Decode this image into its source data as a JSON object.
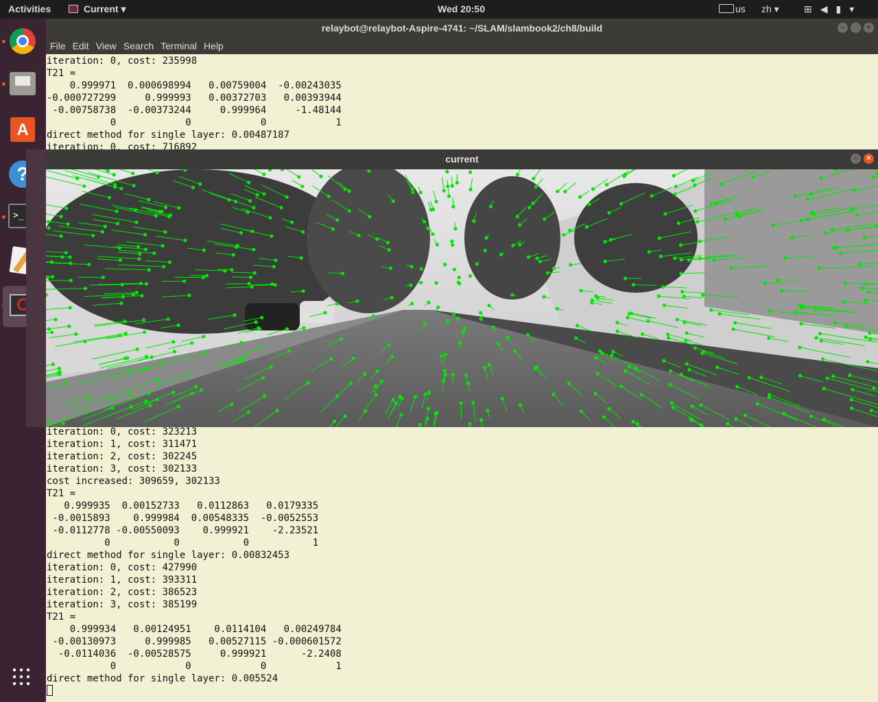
{
  "topbar": {
    "activities": "Activities",
    "app_menu": "Current",
    "clock": "Wed 20:50",
    "keyboard_layout": "us",
    "input_method": "zh"
  },
  "launcher": {
    "apps": [
      "chrome-icon",
      "files-icon",
      "software-center-icon",
      "help-icon",
      "terminal-icon",
      "text-editor-icon",
      "current-app-icon",
      "show-apps-icon"
    ],
    "accent": "#e95420"
  },
  "terminal": {
    "title": "relaybot@relaybot-Aspire-4741: ~/SLAM/slambook2/ch8/build",
    "menu": [
      "File",
      "Edit",
      "View",
      "Search",
      "Terminal",
      "Help"
    ],
    "background": "#f2f1d3",
    "output_top": "iteration: 0, cost: 235998\nT21 =\n    0.999971  0.000698994   0.00759004  -0.00243035\n-0.000727299     0.999993   0.00372703   0.00393944\n -0.00758738  -0.00373244     0.999964     -1.48144\n           0            0            0            1\ndirect method for single layer: 0.00487187\niteration: 0, cost: 716892",
    "output_bottom": "iteration: 0, cost: 323213\niteration: 1, cost: 311471\niteration: 2, cost: 302245\niteration: 3, cost: 302133\ncost increased: 309659, 302133\nT21 =\n   0.999935  0.00152733   0.0112863   0.0179335\n -0.0015893    0.999984  0.00548335  -0.0052553\n -0.0112778 -0.00550093    0.999921    -2.23521\n          0           0           0           1\ndirect method for single layer: 0.00832453\niteration: 0, cost: 427990\niteration: 1, cost: 393311\niteration: 2, cost: 386523\niteration: 3, cost: 385199\nT21 =\n    0.999934   0.00124951    0.0114104   0.00249784\n -0.00130973     0.999985   0.00527115 -0.000601572\n  -0.0114036  -0.00528575     0.999921      -2.2408\n           0            0            0            1\ndirect method for single layer: 0.005524"
  },
  "image_window": {
    "title": "current",
    "overlay_color": "#00e600"
  }
}
